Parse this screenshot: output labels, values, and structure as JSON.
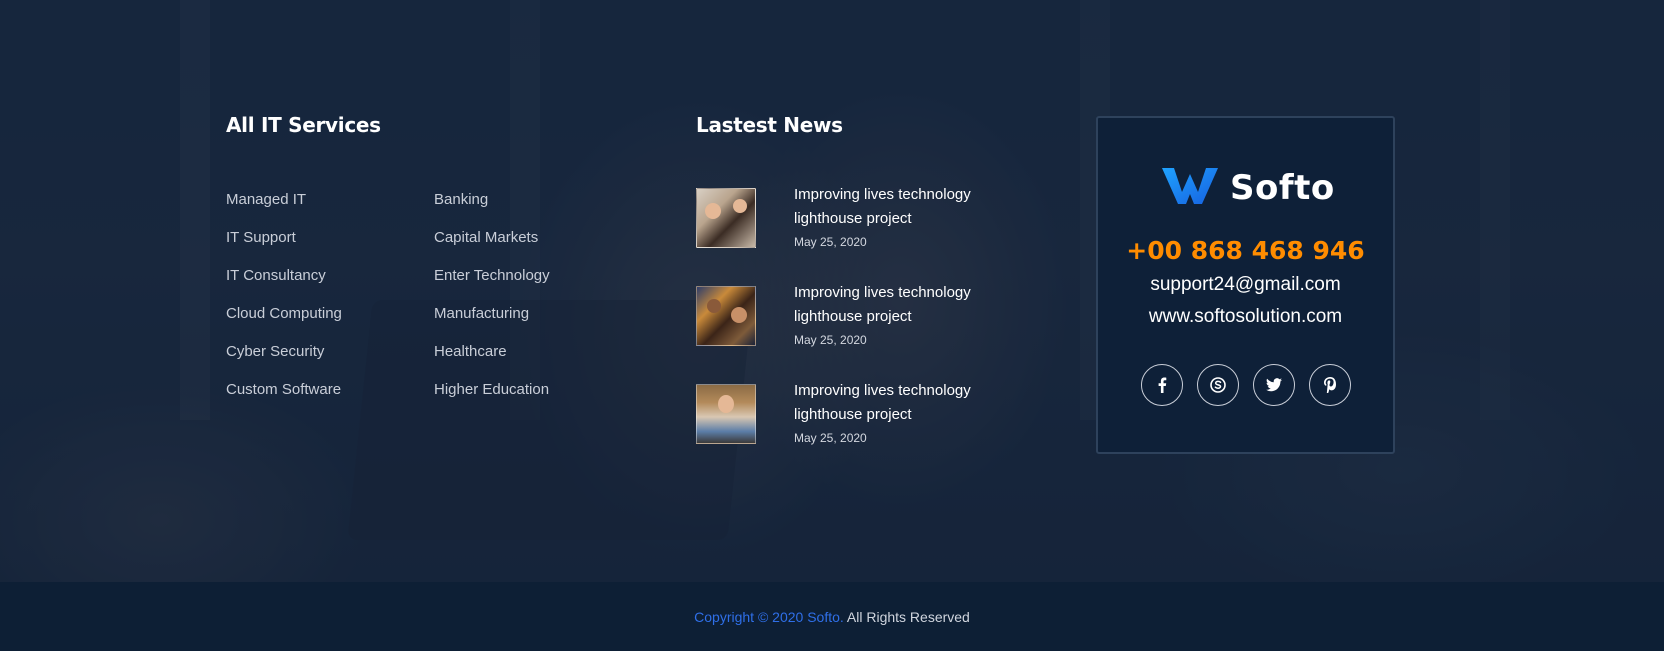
{
  "services": {
    "title": "All IT Services",
    "col1": [
      "Managed IT",
      "IT Support",
      "IT Consultancy",
      "Cloud Computing",
      "Cyber Security",
      "Custom Software"
    ],
    "col2": [
      "Banking",
      "Capital Markets",
      "Enter Technology",
      "Manufacturing",
      "Healthcare",
      "Higher Education"
    ]
  },
  "news": {
    "title": "Lastest News",
    "items": [
      {
        "title": "Improving lives technology lighthouse project",
        "date": "May 25, 2020"
      },
      {
        "title": "Improving lives technology lighthouse project",
        "date": "May 25, 2020"
      },
      {
        "title": "Improving lives technology lighthouse project",
        "date": "May 25, 2020"
      }
    ]
  },
  "contact": {
    "logo_text": "Softo",
    "phone": "+00 868 468 946",
    "email": "support24@gmail.com",
    "website": "www.softosolution.com",
    "socials": [
      {
        "icon": "facebook-icon",
        "glyph": "f"
      },
      {
        "icon": "skype-icon",
        "glyph": "S"
      },
      {
        "icon": "twitter-icon",
        "glyph": "t"
      },
      {
        "icon": "pinterest-icon",
        "glyph": "P"
      }
    ]
  },
  "footer": {
    "brand": "Copyright © 2020 Softo.",
    "rest": " All Rights Reserved"
  },
  "colors": {
    "accent_orange": "#ff8c00",
    "accent_blue": "#2f6fe8",
    "footer_bg": "#0d1f35"
  }
}
